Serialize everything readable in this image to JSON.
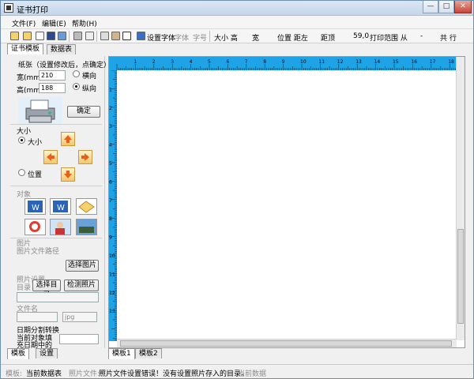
{
  "window": {
    "title": "证书打印",
    "controls": {
      "minimize": "—",
      "maximize": "□",
      "close": "✕"
    }
  },
  "menu": [
    "文件(F)",
    "编辑(E)",
    "帮助(H)"
  ],
  "toolbar": {
    "text_settings": "设置字体",
    "font_label": "字体",
    "size_label": "字号",
    "size_height": "大小 高",
    "width": "宽",
    "position": "位置 距左",
    "top_dist": "距顶",
    "position_value": "59,0",
    "print_range": "打印范围 从",
    "dash": "-",
    "total": "共 行"
  },
  "tabs_top": [
    "证书模板",
    "数据表"
  ],
  "left": {
    "paper_label": "纸张（设置修改后，点确定）",
    "width_label": "宽(mm)",
    "width_value": "210",
    "height_label": "高(mm)",
    "height_value": "188",
    "orient_landscape": "横向",
    "orient_portrait": "纵向",
    "confirm": "确定",
    "size_section": "大小",
    "size_radio": "大小",
    "position_radio": "位置",
    "object_section": "对象",
    "image_section": "图片",
    "image_path": "图片文件路径",
    "select_image": "选择图片",
    "photo_settings": "照片设置",
    "dir_label": "目录",
    "select_dir": "选择目录",
    "detect_photo": "检测照片",
    "filename": "文件名",
    "ext": "jpg",
    "date_split": "日期分割转换",
    "current_object_fill": "当前对象填",
    "fill_date": "充日期中的"
  },
  "ruler": {
    "h_ticks": [
      "1",
      "2",
      "3",
      "4",
      "5",
      "6",
      "7",
      "8",
      "9",
      "10",
      "11",
      "12",
      "13",
      "14",
      "15",
      "16",
      "17",
      "18"
    ],
    "v_ticks": [
      "1",
      "2",
      "3",
      "4",
      "5",
      "6",
      "7",
      "8",
      "9",
      "10",
      "11",
      "12",
      "13"
    ]
  },
  "tabs_bottom_left": [
    "模板",
    "设置"
  ],
  "tabs_bottom_mid": [
    "模板1",
    "模板2"
  ],
  "status": {
    "template_label": "模板:",
    "template_value": "当前数据表",
    "photo_label": "照片文件:",
    "photo_message": "照片文件设置错误！没有设置照片存入的目录。",
    "current_data": "当前数据"
  },
  "colors": {
    "ruler": "#1ea4e6",
    "accent_arrow": "#f3c66b"
  }
}
